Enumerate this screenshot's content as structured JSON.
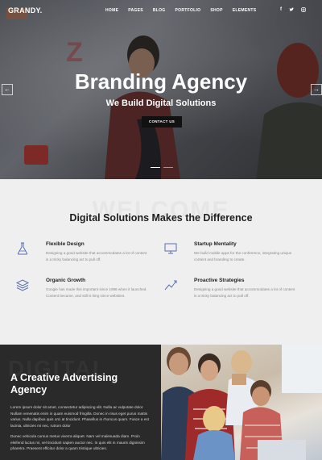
{
  "header": {
    "logo": "GRANDY.",
    "menu": [
      "HOME",
      "PAGES",
      "BLOG",
      "PORTFOLIO",
      "SHOP",
      "ELEMENTS"
    ],
    "social_icons": [
      "facebook-icon",
      "twitter-icon",
      "instagram-icon"
    ],
    "social_glyphs": [
      "f",
      "●",
      "▢"
    ]
  },
  "hero": {
    "title": "Branding Agency",
    "subtitle": "We Build Digital Solutions",
    "button": "CONTACT US",
    "prev_glyph": "←",
    "next_glyph": "→",
    "slides_total": 2,
    "active_slide": 1
  },
  "services": {
    "bg_word": "WELCOME",
    "title": "Digital Solutions Makes the Difference",
    "items": [
      {
        "icon": "flask-icon",
        "title": "Flexible Design",
        "text": "Designing a good website that accommodates a lot of content is a tricky balancing act to pull off."
      },
      {
        "icon": "monitor-icon",
        "title": "Startup Mentality",
        "text": "We build mobile apps for the conference, integrating unique content and branding to create."
      },
      {
        "icon": "layers-icon",
        "title": "Organic Growth",
        "text": "Google has made this important since 1998 when it launched. Content became, and still is king since websites."
      },
      {
        "icon": "chart-line-icon",
        "title": "Proactive Strategies",
        "text": "Designing a good website that accommodates a lot of content is a tricky balancing act to pull off."
      }
    ]
  },
  "creative": {
    "bg_word": "DIGITAL",
    "title": "A Creative Advertising Agency",
    "para1": "Lorem ipsum dolor sit amet, consectetur adipiscing elit. Nulla ac vulputate dolor. Nullam venenatis enim in quam euismod fringilla. Donec in risus eget purus mattis varius. Nulla dapibus quis orci at tincidunt. Phasellus in rhoncus quam. Fusce a est lacinia, ultricies mi nec, rutrum dolor",
    "para2": "Donec vehicula cursus metus viverra aliquet. Nam vel malesuada diam. Proin eleifend luctus mi, vel tincidunt sapien auctor nec. In quis elit in mauris dignissim pharetra. Praesent efficitur dolor a quam tristique ultricies."
  },
  "colors": {
    "hero_overlay": "#19191e",
    "services_bg": "#efefef",
    "icon_accent": "#5a6fb0",
    "dark_panel": "#2a2a2a",
    "button_bg": "#111111"
  }
}
